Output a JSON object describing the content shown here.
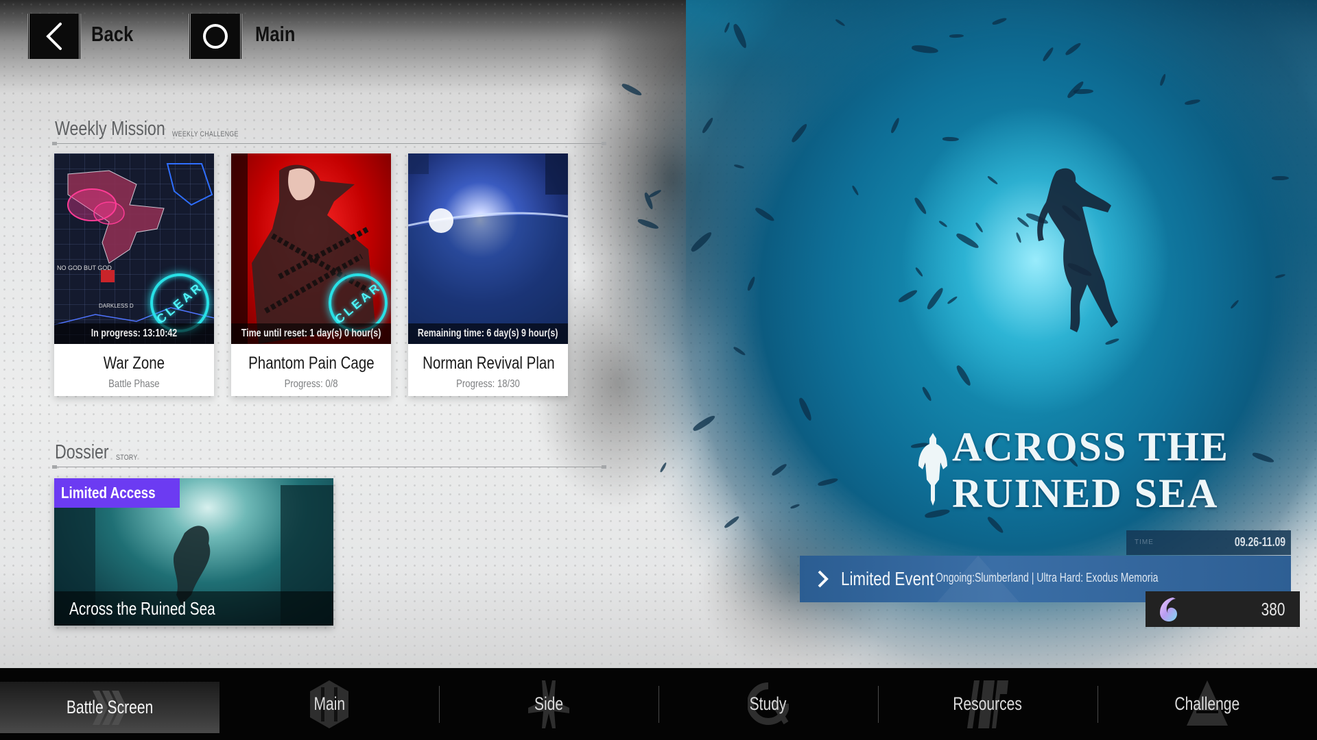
{
  "header": {
    "back_label": "Back",
    "main_label": "Main"
  },
  "weekly": {
    "title": "Weekly Mission",
    "subtitle": "WEEKLY CHALLENGE",
    "cards": [
      {
        "title": "War Zone",
        "subtitle": "Battle Phase",
        "status": "In progress: 13:10:42",
        "cleared": true,
        "clear_text": "CLEAR"
      },
      {
        "title": "Phantom Pain Cage",
        "subtitle": "Progress: 0/8",
        "status": "Time until reset: 1 day(s) 0 hour(s)",
        "cleared": true,
        "clear_text": "CLEAR"
      },
      {
        "title": "Norman Revival Plan",
        "subtitle": "Progress: 18/30",
        "status": "Remaining time: 6 day(s) 9 hour(s)",
        "cleared": false
      }
    ]
  },
  "dossier": {
    "title": "Dossier",
    "subtitle": "STORY",
    "card": {
      "badge": "Limited Access",
      "caption": "Across the Ruined Sea"
    }
  },
  "event": {
    "title_line1": "ACROSS THE",
    "title_line2": "RUINED SEA",
    "time_label": "TIME",
    "time_value": "09.26-11.09",
    "bar_label": "Limited Event",
    "bar_desc": "Ongoing:Slumberland | Ultra Hard: Exodus Memoria",
    "currency_icon": "shell-icon",
    "currency_value": "380"
  },
  "nav": {
    "items": [
      {
        "label": "Battle Screen",
        "icon": "chevron-stack-icon",
        "active": true
      },
      {
        "label": "Main",
        "icon": "hexagon-icon",
        "active": false
      },
      {
        "label": "Side",
        "icon": "cross-emblem-icon",
        "active": false
      },
      {
        "label": "Study",
        "icon": "ring-icon",
        "active": false
      },
      {
        "label": "Resources",
        "icon": "ior-emblem-icon",
        "active": false
      },
      {
        "label": "Challenge",
        "icon": "triangle-icon",
        "active": false
      }
    ]
  },
  "colors": {
    "limited_access_badge": "#6c3bf2",
    "event_bar": "#3a6ea6",
    "clear_glow": "#29d8e8"
  }
}
